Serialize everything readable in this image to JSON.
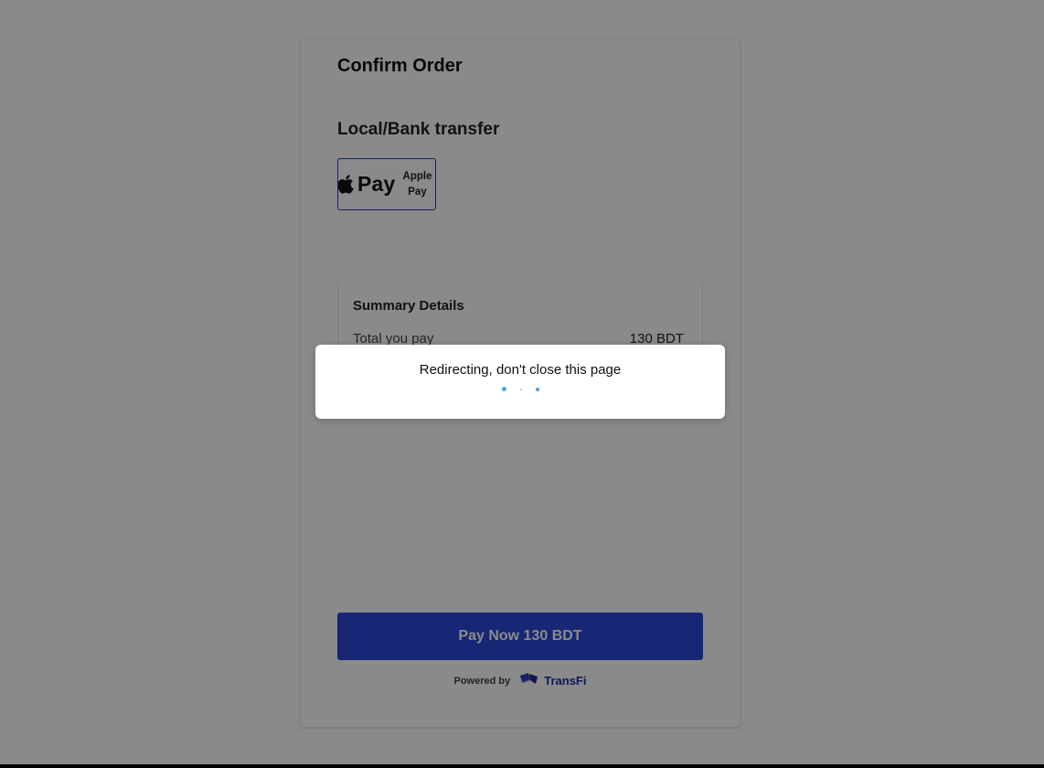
{
  "page": {
    "title": "Confirm Order",
    "payment_section_title": "Local/Bank transfer",
    "payment_methods": [
      {
        "logo_text": "Pay",
        "name": "Apple Pay",
        "name_line1": "Apple",
        "name_line2": "Pay",
        "icon": "apple-icon",
        "selected": true
      }
    ]
  },
  "summary": {
    "title": "Summary Details",
    "rows": [
      {
        "label": "Total you pay",
        "value": "130 BDT"
      }
    ]
  },
  "pay_button": {
    "label": "Pay Now 130 BDT"
  },
  "footer": {
    "powered_by": "Powered by",
    "brand": "TransFi",
    "brand_icon": "transfi-logo-icon"
  },
  "modal": {
    "message": "Redirecting, don't close this page",
    "loader_icon": "loading-dots-icon"
  },
  "colors": {
    "primary": "#2b48d8",
    "brand": "#1a2ea8",
    "loader": "#4aa3e8",
    "overlay": "rgba(0,0,0,0.46)"
  }
}
